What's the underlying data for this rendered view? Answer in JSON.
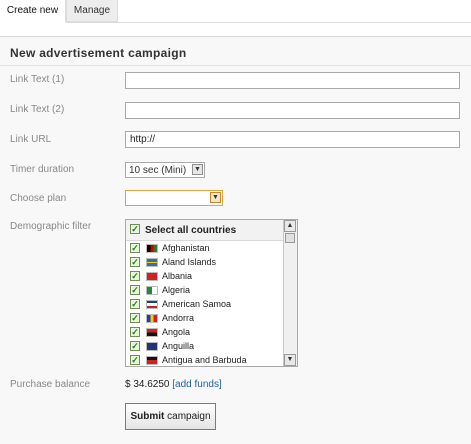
{
  "tabs": [
    {
      "label": "Create new",
      "active": true
    },
    {
      "label": "Manage",
      "active": false
    }
  ],
  "panel": {
    "title": "New advertisement campaign"
  },
  "form": {
    "link_text_1": {
      "label": "Link Text (1)",
      "value": ""
    },
    "link_text_2": {
      "label": "Link Text (2)",
      "value": ""
    },
    "link_url": {
      "label": "Link URL",
      "value": "http://"
    },
    "timer": {
      "label": "Timer duration",
      "value": "10 sec (Mini)"
    },
    "plan": {
      "label": "Choose plan",
      "value": "",
      "highlight_color": "#e8a23c"
    },
    "demographic": {
      "label": "Demographic filter",
      "select_all": "Select all countries",
      "countries": [
        {
          "name": "Afghanistan",
          "checked": true,
          "flag": "flag-icon"
        },
        {
          "name": "Aland Islands",
          "checked": true,
          "flag": "flag-icon"
        },
        {
          "name": "Albania",
          "checked": true,
          "flag": "flag-icon"
        },
        {
          "name": "Algeria",
          "checked": true,
          "flag": "flag-icon"
        },
        {
          "name": "American Samoa",
          "checked": true,
          "flag": "flag-icon"
        },
        {
          "name": "Andorra",
          "checked": true,
          "flag": "flag-icon"
        },
        {
          "name": "Angola",
          "checked": true,
          "flag": "flag-icon"
        },
        {
          "name": "Anguilla",
          "checked": true,
          "flag": "flag-icon"
        },
        {
          "name": "Antigua and Barbuda",
          "checked": true,
          "flag": "flag-icon"
        }
      ]
    },
    "balance": {
      "label": "Purchase balance",
      "amount": "$ 34.6250",
      "add_funds": "[add funds]"
    },
    "submit": {
      "bold": "Submit",
      "rest": " campaign"
    }
  },
  "colors": {
    "link": "#1e5fa8",
    "check": "#2b7a17",
    "accent": "#e8a23c"
  }
}
